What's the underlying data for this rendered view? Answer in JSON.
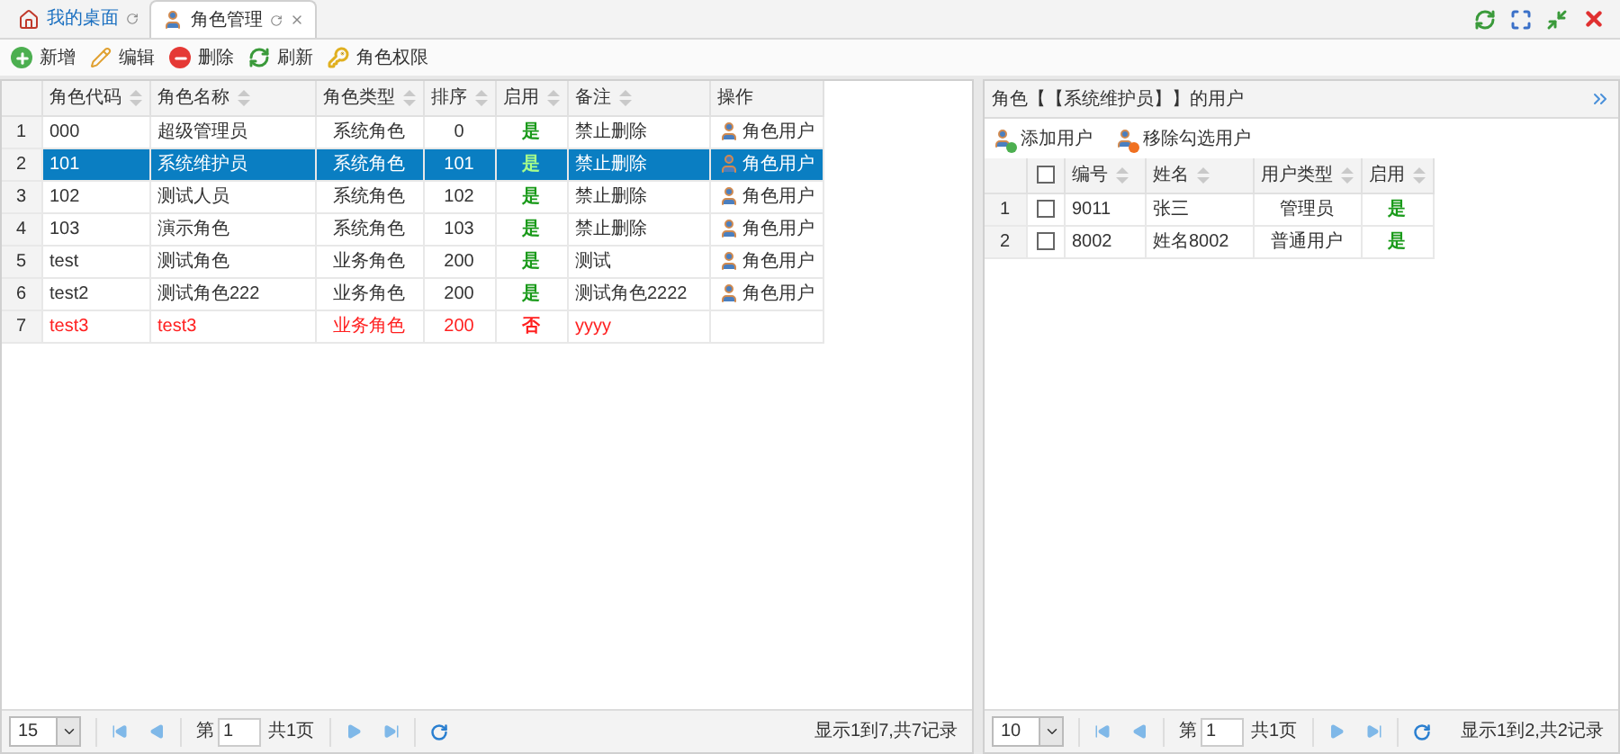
{
  "tabs": [
    {
      "label": "我的桌面",
      "selected": false,
      "closable": false
    },
    {
      "label": "角色管理",
      "selected": true,
      "closable": true
    }
  ],
  "toolbar": [
    {
      "label": "新增",
      "kind": "add"
    },
    {
      "label": "编辑",
      "kind": "edit"
    },
    {
      "label": "删除",
      "kind": "delete"
    },
    {
      "label": "刷新",
      "kind": "refresh"
    },
    {
      "label": "角色权限",
      "kind": "key"
    }
  ],
  "roles": {
    "columns": [
      "角色代码",
      "角色名称",
      "角色类型",
      "排序",
      "启用",
      "备注",
      "操作"
    ],
    "rows": [
      {
        "index": "1",
        "code": "000",
        "name": "超级管理员",
        "type": "系统角色",
        "order": "0",
        "enabled": "是",
        "note": "禁止删除",
        "action": "角色用户",
        "selected": false,
        "disabled": false
      },
      {
        "index": "2",
        "code": "101",
        "name": "系统维护员",
        "type": "系统角色",
        "order": "101",
        "enabled": "是",
        "note": "禁止删除",
        "action": "角色用户",
        "selected": true,
        "disabled": false
      },
      {
        "index": "3",
        "code": "102",
        "name": "测试人员",
        "type": "系统角色",
        "order": "102",
        "enabled": "是",
        "note": "禁止删除",
        "action": "角色用户",
        "selected": false,
        "disabled": false
      },
      {
        "index": "4",
        "code": "103",
        "name": "演示角色",
        "type": "系统角色",
        "order": "103",
        "enabled": "是",
        "note": "禁止删除",
        "action": "角色用户",
        "selected": false,
        "disabled": false
      },
      {
        "index": "5",
        "code": "test",
        "name": "测试角色",
        "type": "业务角色",
        "order": "200",
        "enabled": "是",
        "note": "测试",
        "action": "角色用户",
        "selected": false,
        "disabled": false
      },
      {
        "index": "6",
        "code": "test2",
        "name": "测试角色222",
        "type": "业务角色",
        "order": "200",
        "enabled": "是",
        "note": "测试角色2222",
        "action": "角色用户",
        "selected": false,
        "disabled": false
      },
      {
        "index": "7",
        "code": "test3",
        "name": "test3",
        "type": "业务角色",
        "order": "200",
        "enabled": "否",
        "note": "yyyy",
        "selected": false,
        "disabled": true
      }
    ],
    "pager": {
      "page_size": "15",
      "page_label": "第",
      "page": "1",
      "total_pages": "共1页",
      "summary": "显示1到7,共7记录"
    }
  },
  "users": {
    "title": "角色【【系统维护员】】的用户",
    "toolbar": [
      {
        "label": "添加用户",
        "kind": "add"
      },
      {
        "label": "移除勾选用户",
        "kind": "remove"
      }
    ],
    "all_checked": false,
    "columns": [
      "编号",
      "姓名",
      "用户类型",
      "启用"
    ],
    "rows": [
      {
        "index": "1",
        "id": "9011",
        "name": "张三",
        "type": "管理员",
        "enabled": "是",
        "checked": false
      },
      {
        "index": "2",
        "id": "8002",
        "name": "姓名8002",
        "type": "普通用户",
        "enabled": "是",
        "checked": false
      }
    ],
    "pager": {
      "page_size": "10",
      "page_label": "第",
      "page": "1",
      "total_pages": "共1页",
      "summary": "显示1到2,共2记录"
    }
  }
}
